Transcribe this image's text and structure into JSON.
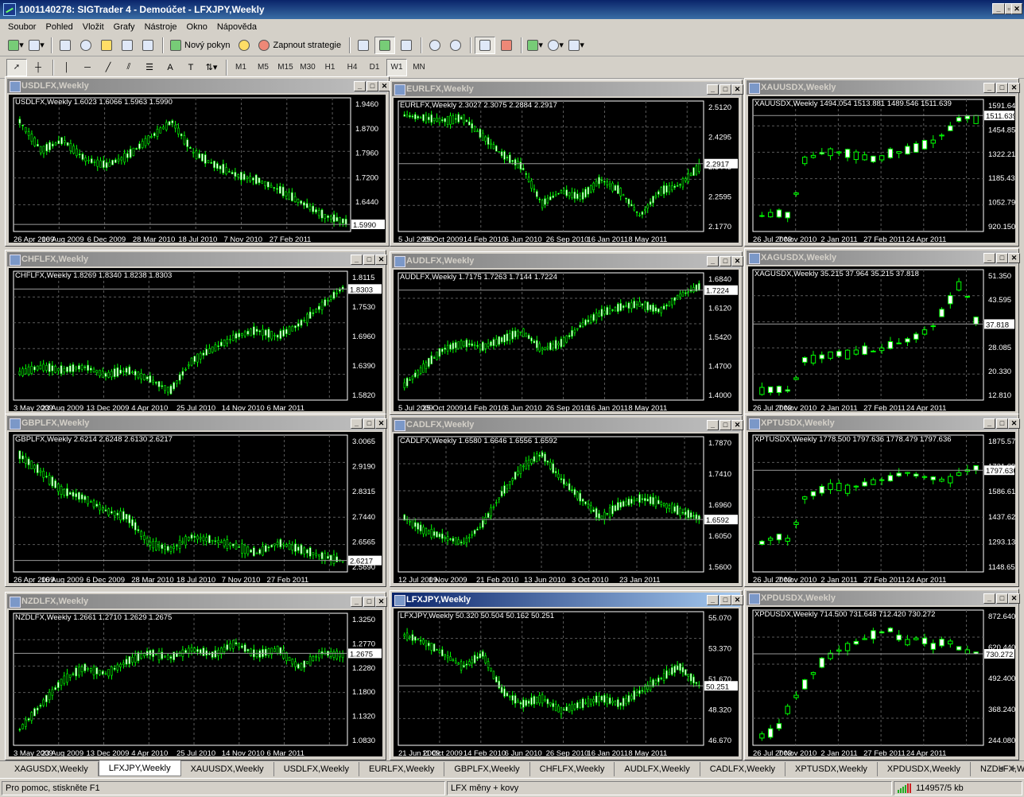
{
  "app": {
    "title": "1001140278: SIGTrader 4 - Demoúčet - LFXJPY,Weekly"
  },
  "menu": [
    "Soubor",
    "Pohled",
    "Vložit",
    "Grafy",
    "Nástroje",
    "Okno",
    "Nápověda"
  ],
  "toolbar": {
    "new_order": "Nový pokyn",
    "auto_trading": "Zapnout strategie",
    "timeframes": [
      "M1",
      "M5",
      "M15",
      "M30",
      "H1",
      "H4",
      "D1",
      "W1",
      "MN"
    ],
    "active_timeframe": "W1"
  },
  "colors": {
    "candle": "#00ff00",
    "grid": "#3a4a3a",
    "text": "#ffffff"
  },
  "charts": [
    {
      "id": "usdlfx",
      "title": "USDLFX,Weekly",
      "header": "USDLFX,Weekly  1.6023 1.6066 1.5963 1.5990",
      "last": "1.5990",
      "ticks": [
        "1.9460",
        "1.8700",
        "1.7960",
        "1.7200",
        "1.6440",
        "1.5700"
      ],
      "dates": [
        "26 Apr 2009",
        "16 Aug 2009",
        "6 Dec 2009",
        "28 Mar 2010",
        "18 Jul 2010",
        "7 Nov 2010",
        "27 Feb 2011"
      ]
    },
    {
      "id": "eurlfx",
      "title": "EURLFX,Weekly",
      "header": "EURLFX,Weekly  2.3027 2.3075 2.2884 2.2917",
      "last": "2.2917",
      "ticks": [
        "2.5120",
        "2.4295",
        "2.3445",
        "2.2595",
        "2.1770"
      ],
      "dates": [
        "5 Jul 2009",
        "25 Oct 2009",
        "14 Feb 2010",
        "6 Jun 2010",
        "26 Sep 2010",
        "16 Jan 2011",
        "8 May 2011"
      ]
    },
    {
      "id": "xauusdx",
      "title": "XAUUSDX,Weekly",
      "header": "XAUUSDX,Weekly  1494.054 1513.881 1489.546 1511.639",
      "last": "1511.639",
      "ticks": [
        "1591.646",
        "1454.857",
        "1322.215",
        "1185.430",
        "1052.790",
        "920.150"
      ],
      "dates": [
        "26 Jul 2009",
        "7 Nov 2010",
        "2 Jan 2011",
        "27 Feb 2011",
        "24 Apr 2011"
      ]
    },
    {
      "id": "chflfx",
      "title": "CHFLFX,Weekly",
      "header": "CHFLFX,Weekly  1.8269 1.8340 1.8238 1.8303",
      "last": "1.8303",
      "ticks": [
        "1.8115",
        "1.7530",
        "1.6960",
        "1.6390",
        "1.5820"
      ],
      "dates": [
        "3 May 2009",
        "23 Aug 2009",
        "13 Dec 2009",
        "4 Apr 2010",
        "25 Jul 2010",
        "14 Nov 2010",
        "6 Mar 2011"
      ]
    },
    {
      "id": "audlfx",
      "title": "AUDLFX,Weekly",
      "header": "AUDLFX,Weekly  1.7175 1.7263 1.7144 1.7224",
      "last": "1.7224",
      "ticks": [
        "1.6840",
        "1.6120",
        "1.5420",
        "1.4700",
        "1.4000"
      ],
      "dates": [
        "5 Jul 2009",
        "25 Oct 2009",
        "14 Feb 2010",
        "6 Jun 2010",
        "26 Sep 2010",
        "16 Jan 2011",
        "8 May 2011"
      ]
    },
    {
      "id": "xagusdx",
      "title": "XAGUSDX,Weekly",
      "header": "XAGUSDX,Weekly  35.215 37.964 35.215 37.818",
      "last": "37.818",
      "ticks": [
        "51.350",
        "43.595",
        "35.840",
        "28.085",
        "20.330",
        "12.810"
      ],
      "dates": [
        "26 Jul 2009",
        "7 Nov 2010",
        "2 Jan 2011",
        "27 Feb 2011",
        "24 Apr 2011"
      ]
    },
    {
      "id": "gbplfx",
      "title": "GBPLFX,Weekly",
      "header": "GBPLFX,Weekly  2.6214 2.6248 2.6130 2.6217",
      "last": "2.6217",
      "ticks": [
        "3.0065",
        "2.9190",
        "2.8315",
        "2.7440",
        "2.6565",
        "2.5690"
      ],
      "dates": [
        "26 Apr 2009",
        "16 Aug 2009",
        "6 Dec 2009",
        "28 Mar 2010",
        "18 Jul 2010",
        "7 Nov 2010",
        "27 Feb 2011"
      ]
    },
    {
      "id": "cadlfx",
      "title": "CADLFX,Weekly",
      "header": "CADLFX,Weekly  1.6580 1.6646 1.6556 1.6592",
      "last": "1.6592",
      "ticks": [
        "1.7870",
        "1.7410",
        "1.6960",
        "1.6050",
        "1.5600"
      ],
      "dates": [
        "12 Jul 2009",
        "1 Nov 2009",
        "21 Feb 2010",
        "13 Jun 2010",
        "3 Oct 2010",
        "23 Jan 2011"
      ]
    },
    {
      "id": "xptusdx",
      "title": "XPTUSDX,Weekly",
      "header": "XPTUSDX,Weekly  1778.500 1797.636 1778.479 1797.636",
      "last": "1797.636",
      "ticks": [
        "1875.575",
        "1731.093",
        "1586.611",
        "1437.620",
        "1293.138",
        "1148.656"
      ],
      "dates": [
        "26 Jul 2009",
        "7 Nov 2010",
        "2 Jan 2011",
        "27 Feb 2011",
        "24 Apr 2011"
      ]
    },
    {
      "id": "nzdlfx",
      "title": "NZDLFX,Weekly",
      "header": "NZDLFX,Weekly  1.2661 1.2710 1.2629 1.2675",
      "last": "1.2675",
      "ticks": [
        "1.3250",
        "1.2770",
        "1.2280",
        "1.1800",
        "1.1320",
        "1.0830"
      ],
      "dates": [
        "3 May 2009",
        "23 Aug 2009",
        "13 Dec 2009",
        "4 Apr 2010",
        "25 Jul 2010",
        "14 Nov 2010",
        "6 Mar 2011"
      ]
    },
    {
      "id": "lfxjpy",
      "title": "LFXJPY,Weekly",
      "header": "LFXJPY,Weekly  50.320 50.504 50.162 50.251",
      "last": "50.251",
      "ticks": [
        "55.070",
        "53.370",
        "51.670",
        "48.320",
        "46.670"
      ],
      "dates": [
        "21 Jun 2009",
        "11 Oct 2009",
        "14 Feb 2010",
        "6 Jun 2010",
        "26 Sep 2010",
        "16 Jan 2011",
        "8 May 2011"
      ]
    },
    {
      "id": "xpdusdx",
      "title": "XPDUSDX,Weekly",
      "header": "XPDUSDX,Weekly  714.500 731.648 712.420 730.272",
      "last": "730.272",
      "ticks": [
        "872.640",
        "620.440",
        "492.400",
        "368.240",
        "244.080"
      ],
      "dates": [
        "26 Jul 2009",
        "7 Nov 2010",
        "2 Jan 2011",
        "27 Feb 2011",
        "24 Apr 2011"
      ]
    }
  ],
  "tabs": [
    "XAGUSDX,Weekly",
    "LFXJPY,Weekly",
    "XAUUSDX,Weekly",
    "USDLFX,Weekly",
    "EURLFX,Weekly",
    "GBPLFX,Weekly",
    "CHFLFX,Weekly",
    "AUDLFX,Weekly",
    "CADLFX,Weekly",
    "XPTUSDX,Weekly",
    "XPDUSDX,Weekly",
    "NZDLFX,Weekly"
  ],
  "active_tab": "LFXJPY,Weekly",
  "status": {
    "help": "Pro pomoc, stiskněte F1",
    "profile": "LFX měny + kovy",
    "traffic": "114957/5 kb"
  }
}
